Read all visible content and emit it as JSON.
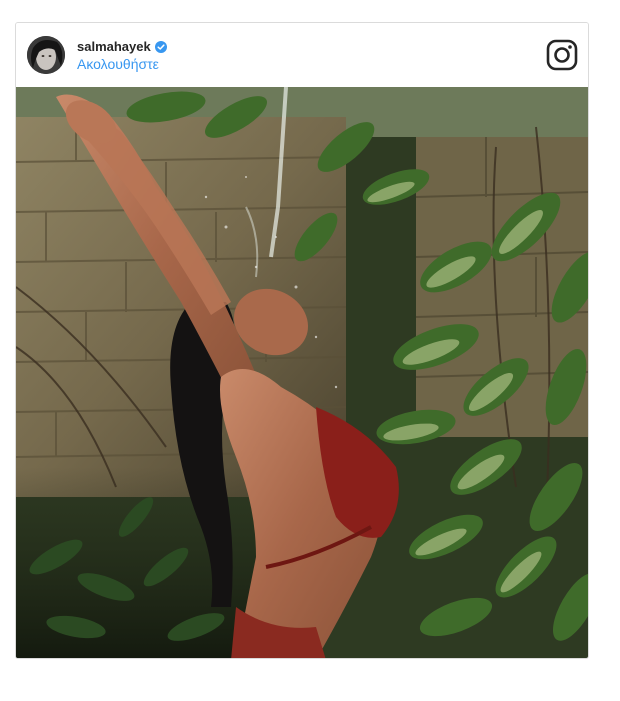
{
  "post": {
    "username": "salmahayek",
    "follow_label": "Ακολουθήστε",
    "verified": true
  },
  "icons": {
    "avatar": "profile-avatar",
    "verified": "verified-badge-icon",
    "logo": "instagram-logo-icon"
  },
  "colors": {
    "username": "#262626",
    "follow": "#3897f0",
    "verified": "#3897f0",
    "border": "#dbdbdb"
  }
}
